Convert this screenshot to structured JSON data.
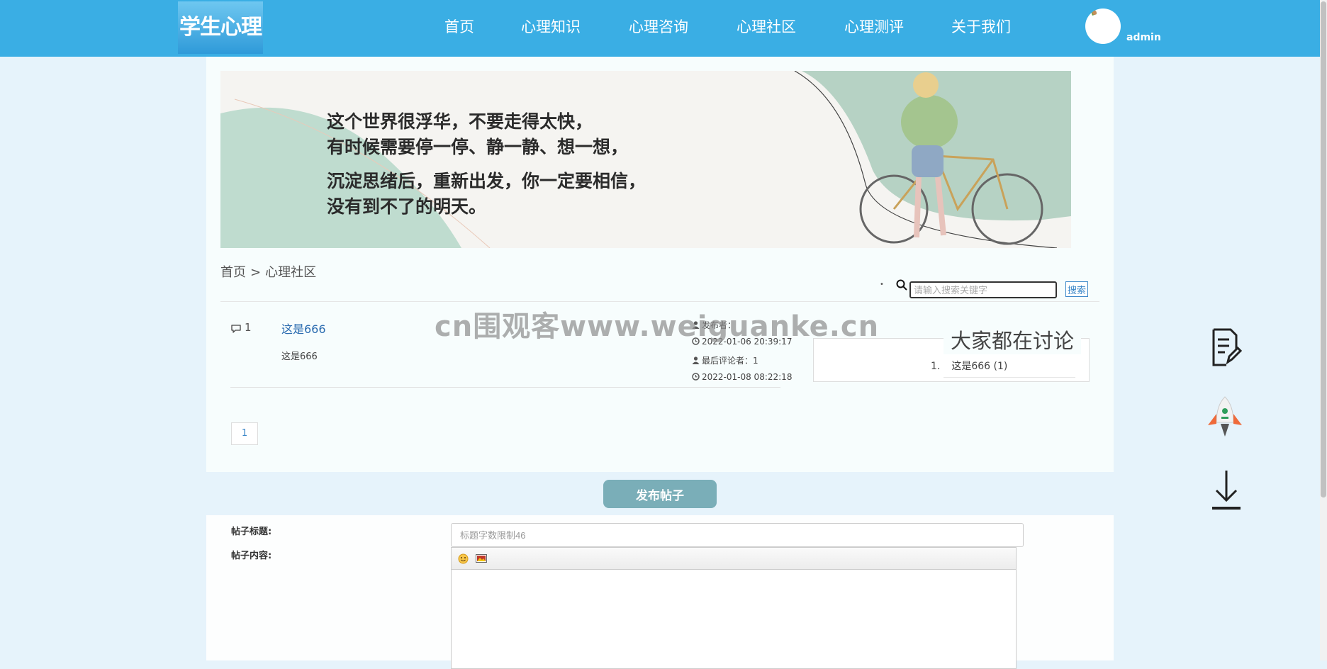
{
  "header": {
    "logo_text": "学生心理健康",
    "nav": [
      "首页",
      "心理知识",
      "心理咨询",
      "心理社区",
      "心理测评",
      "关于我们"
    ],
    "username": "admin"
  },
  "banner": {
    "lines": [
      "这个世界很浮华，不要走得太快，",
      "有时候需要停一停、静一静、想一想，",
      "沉淀思绪后，重新出发，你一定要相信，",
      "没有到不了的明天。"
    ]
  },
  "breadcrumb": {
    "home": "首页",
    "sep": ">",
    "current": "心理社区"
  },
  "search": {
    "placeholder": "请输入搜索关键字",
    "button": "搜索",
    "bullet": "•"
  },
  "posts": [
    {
      "comments": "1",
      "title": "这是666",
      "excerpt": "这是666",
      "publisher": "发布者：",
      "published_at": "2022-01-06 20:39:17",
      "last_commenter": "最后评论者：1",
      "last_commented_at": "2022-01-08 08:22:18"
    }
  ],
  "pagination": {
    "current": "1"
  },
  "sidebar": {
    "title": "大家都在讨论",
    "items": [
      {
        "num": "1.",
        "text": "这是666  (1)"
      }
    ]
  },
  "watermark": "cn围观客www.weiguanke.cn",
  "publish": {
    "button": "发布帖子",
    "title_label": "帖子标题:",
    "title_placeholder": "标题字数限制46",
    "content_label": "帖子内容:"
  },
  "colors": {
    "header": "#3aaee4",
    "accent": "#2b6cb0",
    "publish_button": "#7aaeb8"
  }
}
